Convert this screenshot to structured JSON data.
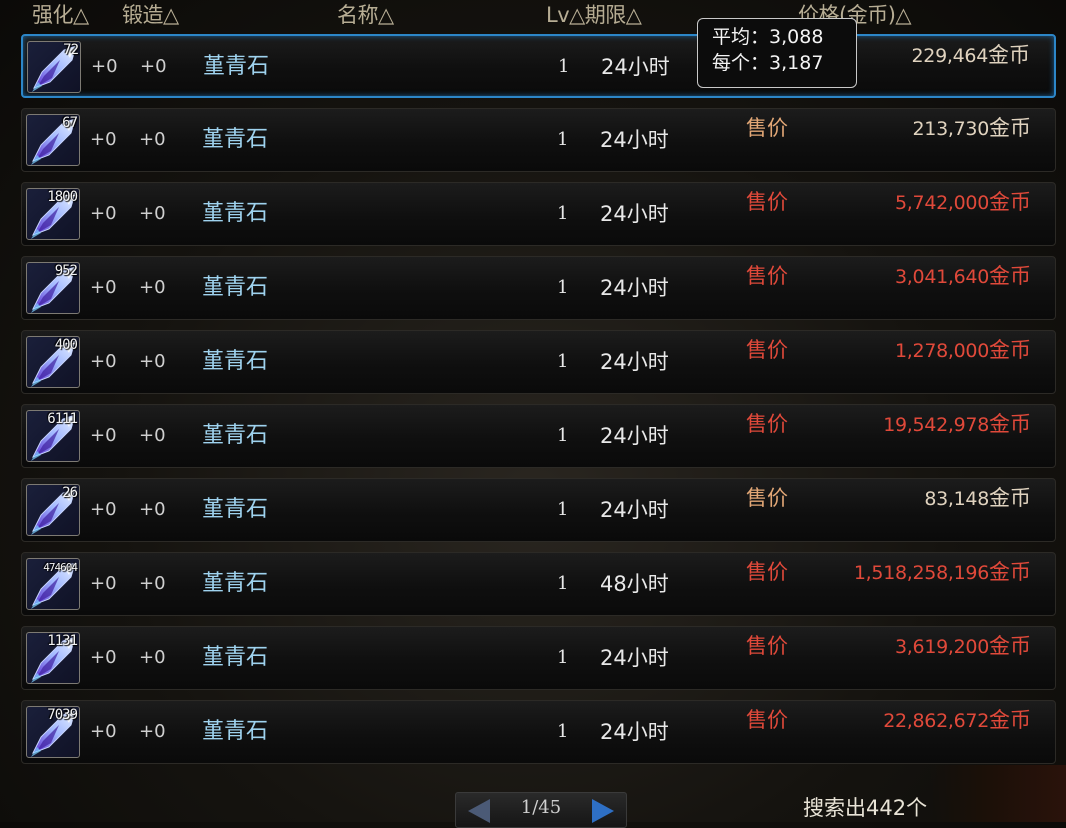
{
  "header": {
    "enhance": "强化△",
    "forge": "锻造△",
    "name": "名称△",
    "lv_period": "Lv△期限△",
    "price": "价格(金币)△"
  },
  "tooltip": {
    "avg_label": "平均",
    "avg_value": "3,088",
    "each_label": "每个",
    "each_value": "3,187",
    "separator": "："
  },
  "listings": [
    {
      "qty": "72",
      "enhance": "+0",
      "forge": "+0",
      "name": "堇青石",
      "lv": "1",
      "period": "24小时",
      "sale": "",
      "price": "229,464",
      "unit": "金币",
      "price_color": "normal",
      "selected": true
    },
    {
      "qty": "67",
      "enhance": "+0",
      "forge": "+0",
      "name": "堇青石",
      "lv": "1",
      "period": "24小时",
      "sale": "售价",
      "price": "213,730",
      "unit": "金币",
      "price_color": "normal"
    },
    {
      "qty": "1800",
      "enhance": "+0",
      "forge": "+0",
      "name": "堇青石",
      "lv": "1",
      "period": "24小时",
      "sale": "售价",
      "price": "5,742,000",
      "unit": "金币",
      "price_color": "red"
    },
    {
      "qty": "952",
      "enhance": "+0",
      "forge": "+0",
      "name": "堇青石",
      "lv": "1",
      "period": "24小时",
      "sale": "售价",
      "price": "3,041,640",
      "unit": "金币",
      "price_color": "red"
    },
    {
      "qty": "400",
      "enhance": "+0",
      "forge": "+0",
      "name": "堇青石",
      "lv": "1",
      "period": "24小时",
      "sale": "售价",
      "price": "1,278,000",
      "unit": "金币",
      "price_color": "red"
    },
    {
      "qty": "6111",
      "enhance": "+0",
      "forge": "+0",
      "name": "堇青石",
      "lv": "1",
      "period": "24小时",
      "sale": "售价",
      "price": "19,542,978",
      "unit": "金币",
      "price_color": "red"
    },
    {
      "qty": "26",
      "enhance": "+0",
      "forge": "+0",
      "name": "堇青石",
      "lv": "1",
      "period": "24小时",
      "sale": "售价",
      "price": "83,148",
      "unit": "金币",
      "price_color": "normal"
    },
    {
      "qty": "474604",
      "enhance": "+0",
      "forge": "+0",
      "name": "堇青石",
      "lv": "1",
      "period": "48小时",
      "sale": "售价",
      "price": "1,518,258,196",
      "unit": "金币",
      "price_color": "red"
    },
    {
      "qty": "1131",
      "enhance": "+0",
      "forge": "+0",
      "name": "堇青石",
      "lv": "1",
      "period": "24小时",
      "sale": "售价",
      "price": "3,619,200",
      "unit": "金币",
      "price_color": "red"
    },
    {
      "qty": "7039",
      "enhance": "+0",
      "forge": "+0",
      "name": "堇青石",
      "lv": "1",
      "period": "24小时",
      "sale": "售价",
      "price": "22,862,672",
      "unit": "金币",
      "price_color": "red"
    }
  ],
  "pager": {
    "page": "1/45"
  },
  "result": "搜索出442个",
  "colors": {
    "red": "#e0493a",
    "normal": "#e0d3bf",
    "sale_normal": "#e2a776",
    "name": "#9fd3ef",
    "selected_border": "#2c86c8"
  }
}
